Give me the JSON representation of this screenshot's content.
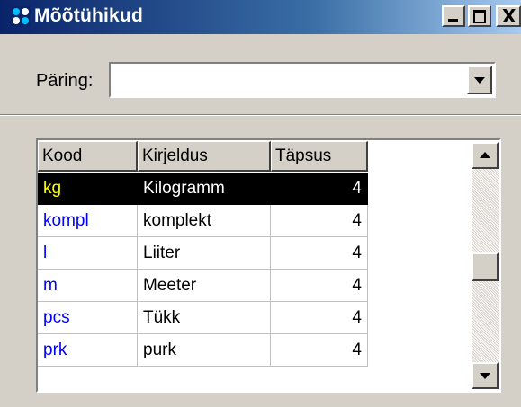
{
  "window": {
    "title": "Mõõtühikud",
    "controls": {
      "minimize": "_",
      "maximize": "□",
      "close": "X"
    },
    "colors": {
      "titlebar": "#0a246a",
      "face": "#d4d0c8",
      "selection": "#000000",
      "selected_code": "#ffff00",
      "code_text": "#0000ff"
    }
  },
  "query": {
    "label": "Päring:",
    "value": ""
  },
  "grid": {
    "columns": [
      "Kood",
      "Kirjeldus",
      "Täpsus"
    ],
    "rows": [
      {
        "kood": "kg",
        "kirjeldus": "Kilogramm",
        "tapsus": "4",
        "selected": true
      },
      {
        "kood": "kompl",
        "kirjeldus": "komplekt",
        "tapsus": "4",
        "selected": false
      },
      {
        "kood": "l",
        "kirjeldus": "Liiter",
        "tapsus": "4",
        "selected": false
      },
      {
        "kood": "m",
        "kirjeldus": "Meeter",
        "tapsus": "4",
        "selected": false
      },
      {
        "kood": "pcs",
        "kirjeldus": "Tükk",
        "tapsus": "4",
        "selected": false
      },
      {
        "kood": "prk",
        "kirjeldus": "purk",
        "tapsus": "4",
        "selected": false
      }
    ]
  },
  "icons": {
    "app": "units-app-icon",
    "combo": "chevron-down-icon",
    "scroll_up": "arrow-up-icon",
    "scroll_down": "arrow-down-icon"
  }
}
